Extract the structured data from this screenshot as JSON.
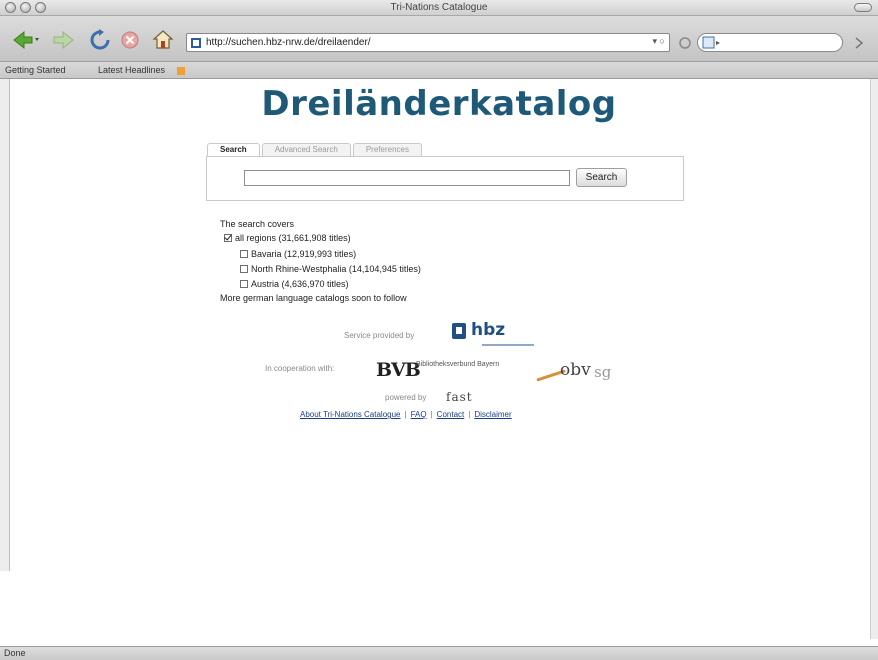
{
  "window": {
    "title": "Tri-Nations Catalogue"
  },
  "toolbar": {
    "url": "http://suchen.hbz-nrw.de/dreilaender/",
    "back_icon": "back-arrow-icon",
    "forward_icon": "forward-arrow-icon",
    "reload_icon": "reload-icon",
    "stop_icon": "stop-icon",
    "home_icon": "home-icon"
  },
  "bookmarks": {
    "items": [
      "Getting Started",
      "Latest Headlines"
    ]
  },
  "page": {
    "headline": "Dreiländerkatalog",
    "tabs": [
      "Search",
      "Advanced Search",
      "Preferences"
    ],
    "search_button": "Search",
    "search_query": "",
    "covers_label": "The search covers",
    "regions": [
      {
        "label": "all regions (31,661,908 titles)",
        "checked": true
      },
      {
        "label": "Bavaria (12,919,993 titles)",
        "checked": false
      },
      {
        "label": "North Rhine-Westphalia (14,104,945 titles)",
        "checked": false
      },
      {
        "label": "Austria (4,636,970 titles)",
        "checked": false
      }
    ],
    "more_note": "More german language catalogs soon to follow",
    "service_label": "Service provided by",
    "hbz_logo_text": "hbz",
    "coop_label": "In cooperation with:",
    "bvb_logo_text": "BVB",
    "bvb_logo_sub": "Bibliotheksverbund Bayern",
    "obv_logo_text": "obv",
    "obv_logo_sub": "sg",
    "powered_label": "powered by",
    "fast_logo_text": "fast",
    "footer_links": [
      "About Tri-Nations Catalogue",
      "FAQ",
      "Contact",
      "Disclaimer"
    ]
  },
  "status": {
    "text": "Done"
  },
  "colors": {
    "headline": "#1e5a78",
    "hbz": "#1f4f86",
    "link": "#1a3e8c"
  }
}
